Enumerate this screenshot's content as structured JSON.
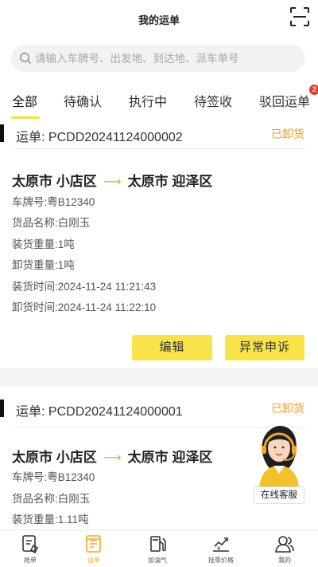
{
  "header": {
    "title": "我的运单"
  },
  "search": {
    "placeholder": "请输入车牌号、出发地、到达地、派车单号"
  },
  "tabs": [
    {
      "label": "全部"
    },
    {
      "label": "待确认"
    },
    {
      "label": "执行中"
    },
    {
      "label": "待签收"
    },
    {
      "label": "驳回运单",
      "badge": "2"
    }
  ],
  "labels": {
    "order_prefix": "运单:",
    "plate": "车牌号:",
    "goods": "货品名称:",
    "load_weight": "装货重量:",
    "unload_weight": "卸货重量:",
    "load_time": "装货时间:",
    "unload_time": "卸货时间:"
  },
  "orders": [
    {
      "order_no": "PCDD20241124000002",
      "status": "已卸货",
      "from_city": "太原市",
      "from_district": "小店区",
      "to_city": "太原市",
      "to_district": "迎泽区",
      "plate": "粤B12340",
      "goods": "白刚玉",
      "load_weight": "1吨",
      "unload_weight": "1吨",
      "load_time": "2024-11-24 11:21:43",
      "unload_time": "2024-11-24 11:22:10",
      "edit_label": "编辑",
      "appeal_label": "异常申诉"
    },
    {
      "order_no": "PCDD20241124000001",
      "status": "已卸货",
      "from_city": "太原市",
      "from_district": "小店区",
      "to_city": "太原市",
      "to_district": "迎泽区",
      "plate": "粤B12340",
      "goods": "白刚玉",
      "load_weight": "1.11吨"
    }
  ],
  "customer_service": {
    "label": "在线客服"
  },
  "tabbar": [
    {
      "label": "抢单",
      "icon": "grab-order-icon"
    },
    {
      "label": "运单",
      "icon": "waybill-icon",
      "active": true
    },
    {
      "label": "加油气",
      "icon": "fuel-icon"
    },
    {
      "label": "挂靠价格",
      "icon": "price-chart-icon"
    },
    {
      "label": "我的",
      "icon": "profile-icon"
    }
  ],
  "colors": {
    "accent": "#f8e448",
    "status": "#f39a24",
    "active_tab": "#f5a623",
    "badge": "#e53b2c"
  }
}
